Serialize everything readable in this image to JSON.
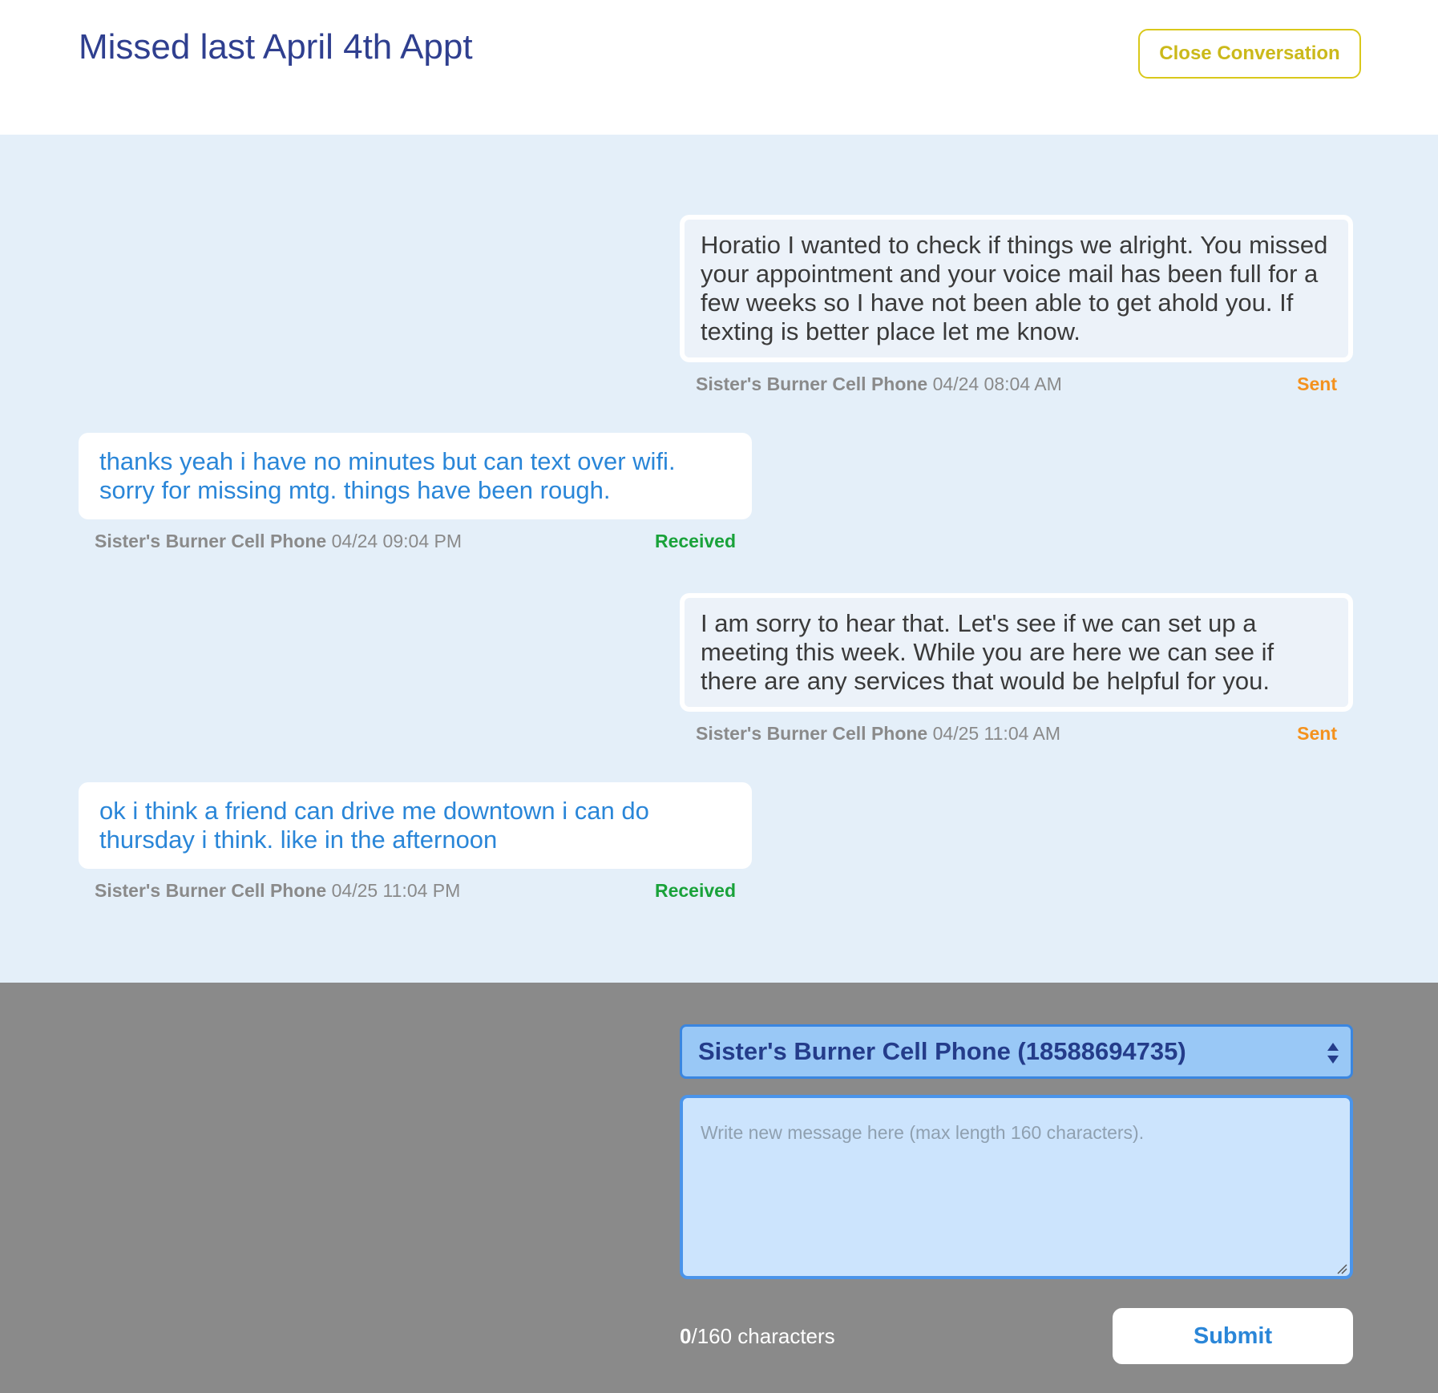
{
  "header": {
    "title": "Missed last April 4th Appt",
    "close_label": "Close Conversation"
  },
  "messages": [
    {
      "direction": "sent",
      "text": "Horatio I wanted to check if things we alright. You missed your appointment and your voice mail has been full for a few weeks so I have not been able to get ahold you. If texting is better place let me know.",
      "sender": "Sister's Burner Cell Phone",
      "timestamp": "04/24 08:04 AM",
      "status": "Sent"
    },
    {
      "direction": "received",
      "text": "thanks yeah i have no minutes but can text over wifi. sorry for missing mtg. things have been rough.",
      "sender": "Sister's Burner Cell Phone",
      "timestamp": "04/24 09:04 PM",
      "status": "Received"
    },
    {
      "direction": "sent",
      "text": "I am sorry to hear that. Let's see if we can set up a meeting this week. While you are here we can see if there are any services that would be helpful for you.",
      "sender": "Sister's Burner Cell Phone",
      "timestamp": "04/25 11:04 AM",
      "status": "Sent"
    },
    {
      "direction": "received",
      "text": "ok i think a friend can drive me downtown i can do thursday i think. like in the afternoon",
      "sender": "Sister's Burner Cell Phone",
      "timestamp": "04/25 11:04 PM",
      "status": "Received"
    }
  ],
  "composer": {
    "recipient": "Sister's Burner Cell Phone (18588694735)",
    "placeholder": "Write new message here (max length 160 characters).",
    "value": "",
    "char_count": "0",
    "char_limit_text": "/160 characters",
    "submit_label": "Submit"
  },
  "colors": {
    "title": "#2f3f8f",
    "close_button": "#d9c81a",
    "conversation_bg": "#e4eff9",
    "sent_status": "#f4921e",
    "received_status": "#19a23a",
    "received_text": "#2a86d8",
    "composer_bg": "#8a8a8a",
    "select_bg": "#99c8f6",
    "textarea_bg": "#cce4fd"
  },
  "icons": {
    "select_arrows": "up-down-arrows-icon",
    "resize": "resize-grip-icon"
  }
}
